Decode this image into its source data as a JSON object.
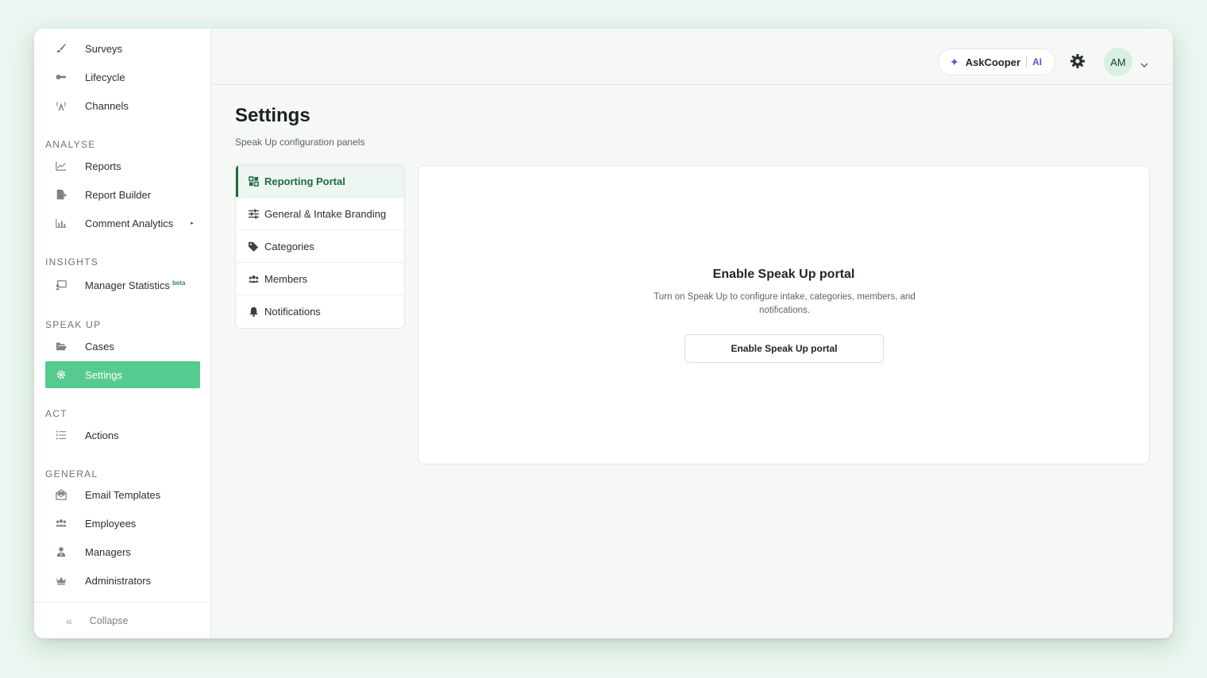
{
  "sidebar": {
    "top_items": [
      {
        "label": "Surveys",
        "icon": "brush-icon"
      },
      {
        "label": "Lifecycle",
        "icon": "key-icon"
      },
      {
        "label": "Channels",
        "icon": "broadcast-icon"
      }
    ],
    "sections": [
      {
        "title": "ANALYSE",
        "items": [
          {
            "label": "Reports",
            "icon": "line-chart-icon"
          },
          {
            "label": "Report Builder",
            "icon": "file-export-icon"
          },
          {
            "label": "Comment Analytics",
            "icon": "bar-chart-icon",
            "caret": "▸"
          }
        ]
      },
      {
        "title": "INSIGHTS",
        "items": [
          {
            "label": "Manager Statistics",
            "badge": "beta",
            "icon": "presentation-icon"
          }
        ]
      },
      {
        "title": "SPEAK UP",
        "items": [
          {
            "label": "Cases",
            "icon": "folder-open-icon"
          },
          {
            "label": "Settings",
            "icon": "gear-icon",
            "active": true
          }
        ]
      },
      {
        "title": "ACT",
        "items": [
          {
            "label": "Actions",
            "icon": "list-icon"
          }
        ]
      },
      {
        "title": "GENERAL",
        "items": [
          {
            "label": "Email Templates",
            "icon": "envelope-open-icon"
          },
          {
            "label": "Employees",
            "icon": "users-icon"
          },
          {
            "label": "Managers",
            "icon": "user-tie-icon"
          },
          {
            "label": "Administrators",
            "icon": "crown-icon"
          }
        ]
      }
    ],
    "collapse": {
      "label": "Collapse",
      "icon": "«"
    }
  },
  "topbar": {
    "askcooper_label": "AskCooper",
    "ai_label": "AI",
    "avatar_initials": "AM"
  },
  "main": {
    "title": "Settings",
    "subtitle": "Speak Up configuration panels",
    "panels": [
      {
        "label": "Reporting Portal",
        "icon": "grid-icon",
        "active": true
      },
      {
        "label": "General & Intake Branding",
        "icon": "sliders-icon"
      },
      {
        "label": "Categories",
        "icon": "tags-icon"
      },
      {
        "label": "Members",
        "icon": "users-icon"
      },
      {
        "label": "Notifications",
        "icon": "bell-icon"
      }
    ],
    "card": {
      "title": "Enable Speak Up portal",
      "description": "Turn on Speak Up to configure intake, categories, members, and notifications.",
      "button_label": "Enable Speak Up portal"
    }
  },
  "colors": {
    "accent": "#56cb8f",
    "accent_dark": "#1f6a3f",
    "ai_purple": "#5b54d6",
    "background": "#eaf6ef"
  }
}
